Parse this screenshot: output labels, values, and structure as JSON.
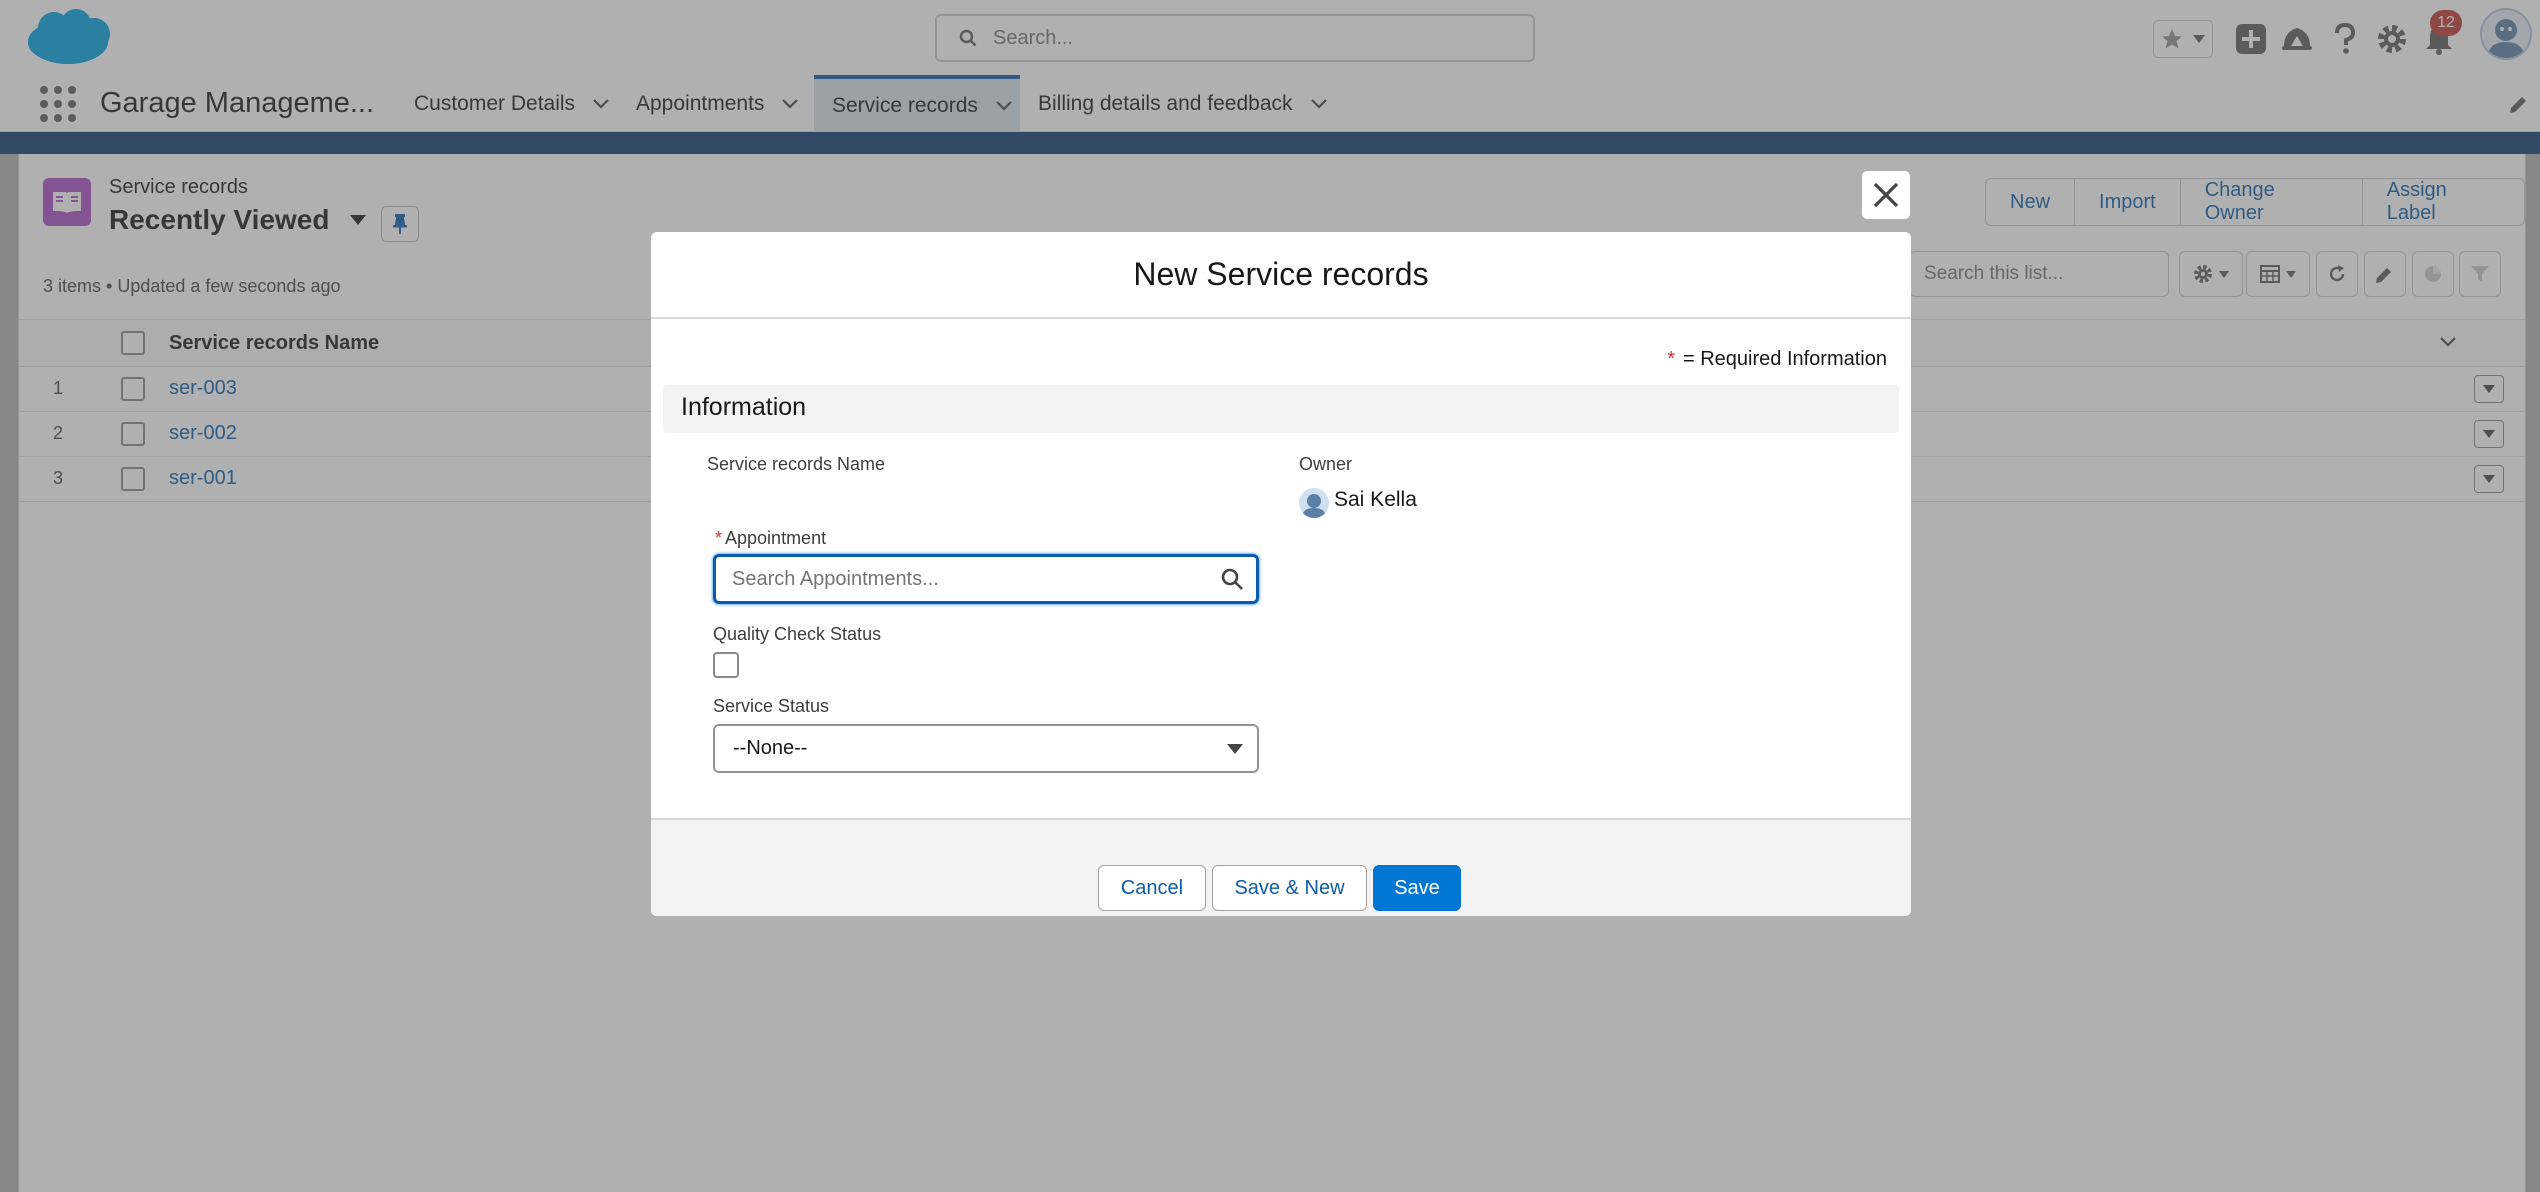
{
  "header": {
    "search_placeholder": "Search...",
    "notification_count": "12"
  },
  "app_nav": {
    "app_name": "Garage Manageme...",
    "tabs": [
      {
        "label": "Customer Details"
      },
      {
        "label": "Appointments"
      },
      {
        "label": "Service records",
        "active": true
      },
      {
        "label": "Billing details and feedback"
      }
    ]
  },
  "list_view": {
    "object_label": "Service records",
    "view_name": "Recently Viewed",
    "meta": "3 items • Updated a few seconds ago",
    "search_placeholder": "Search this list...",
    "actions": [
      "New",
      "Import",
      "Change Owner",
      "Assign Label"
    ],
    "column_header": "Service records Name",
    "rows": [
      {
        "num": "1",
        "name": "ser-003"
      },
      {
        "num": "2",
        "name": "ser-002"
      },
      {
        "num": "3",
        "name": "ser-001"
      }
    ]
  },
  "modal": {
    "title": "New Service records",
    "required_star": "*",
    "required_text": "= Required Information",
    "section_title": "Information",
    "fields": {
      "name_label": "Service records Name",
      "owner_label": "Owner",
      "owner_value": "Sai Kella",
      "appointment_required": "*",
      "appointment_label": "Appointment",
      "appointment_placeholder": "Search Appointments...",
      "qc_label": "Quality Check Status",
      "service_status_label": "Service Status",
      "service_status_value": "--None--"
    },
    "buttons": {
      "cancel": "Cancel",
      "save_new": "Save & New",
      "save": "Save"
    }
  },
  "colors": {
    "brand": "#0176d3",
    "link": "#0b5cab",
    "object_icon": "#a94ec9",
    "required": "#c23934"
  }
}
